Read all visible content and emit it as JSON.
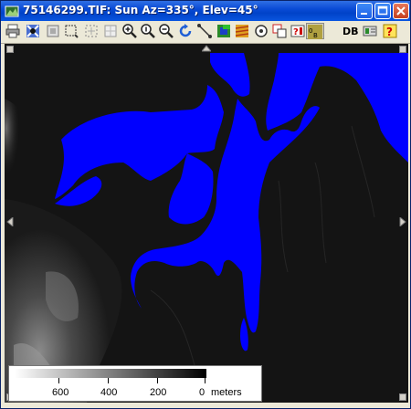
{
  "window": {
    "title": "75146299.TIF: Sun Az=335°, Elev=45°"
  },
  "toolbar": {
    "tools": [
      "print-icon",
      "identify-icon",
      "full-view-icon",
      "zoom-box-icon",
      "select-icon",
      "crop-icon",
      "zoom-in-icon",
      "zoom-normal-icon",
      "zoom-out-icon",
      "redraw-icon",
      "measure-icon",
      "color-map-icon",
      "texture-icon",
      "target-icon",
      "overlay-icon",
      "question-map-icon",
      "coords-icon"
    ],
    "db_label": "DB",
    "help_icon": "help-icon"
  },
  "map": {
    "water_color": "#0000ff",
    "terrain_dark": "#141414"
  },
  "scalebar": {
    "labels": [
      "600",
      "400",
      "200",
      "0"
    ],
    "unit": "meters"
  }
}
